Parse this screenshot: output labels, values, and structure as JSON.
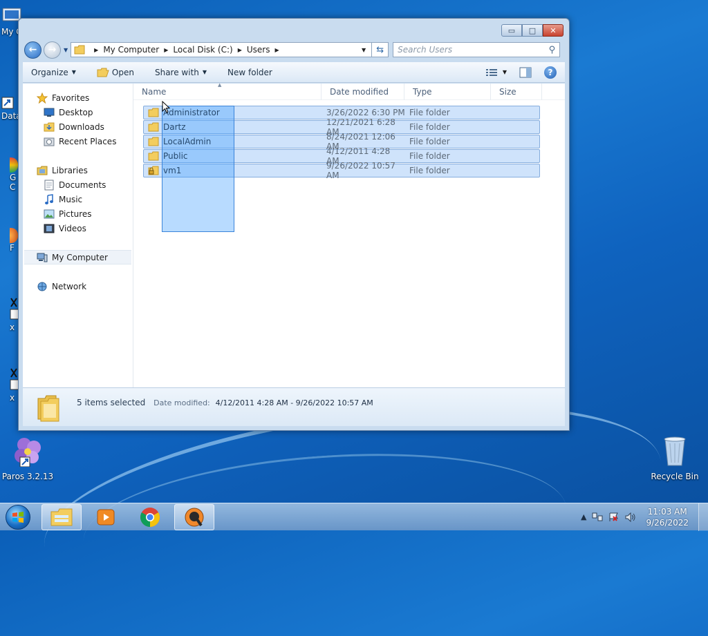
{
  "desktop": {
    "left_labels": [
      "My C",
      "Data",
      "G",
      "C",
      "F",
      "x",
      "x"
    ],
    "paros_label": "Paros 3.2.13",
    "recycle_label": "Recycle Bin"
  },
  "window": {
    "caption_buttons": {
      "minimize": "▭",
      "maximize": "□",
      "close": "✕"
    },
    "address": {
      "crumbs": [
        "My Computer",
        "Local Disk (C:)",
        "Users"
      ]
    },
    "search": {
      "placeholder": "Search Users"
    },
    "toolbar": {
      "organize": "Organize",
      "open": "Open",
      "share_with": "Share with",
      "new_folder": "New folder"
    },
    "nav_pane": {
      "favorites": "Favorites",
      "desktop": "Desktop",
      "downloads": "Downloads",
      "recent_places": "Recent Places",
      "libraries": "Libraries",
      "documents": "Documents",
      "music": "Music",
      "pictures": "Pictures",
      "videos": "Videos",
      "my_computer": "My Computer",
      "network": "Network"
    },
    "columns": {
      "name": "Name",
      "date": "Date modified",
      "type": "Type",
      "size": "Size"
    },
    "files": [
      {
        "name": "Administrator",
        "date": "3/26/2022 6:30 PM",
        "type": "File folder"
      },
      {
        "name": "Dartz",
        "date": "12/21/2021 6:28 AM",
        "type": "File folder"
      },
      {
        "name": "LocalAdmin",
        "date": "8/24/2021 12:06 AM",
        "type": "File folder"
      },
      {
        "name": "Public",
        "date": "4/12/2011 4:28 AM",
        "type": "File folder"
      },
      {
        "name": "vm1",
        "date": "9/26/2022 10:57 AM",
        "type": "File folder"
      }
    ],
    "details": {
      "selected": "5 items selected",
      "date_label": "Date modified:",
      "date_value": "4/12/2011 4:28 AM - 9/26/2022 10:57 AM"
    }
  },
  "taskbar": {
    "time": "11:03 AM",
    "date": "9/26/2022"
  },
  "colors": {
    "selection": "#cfe3fb",
    "selection_border": "#84acdd",
    "desktop_blue": "#1a7ad2"
  }
}
